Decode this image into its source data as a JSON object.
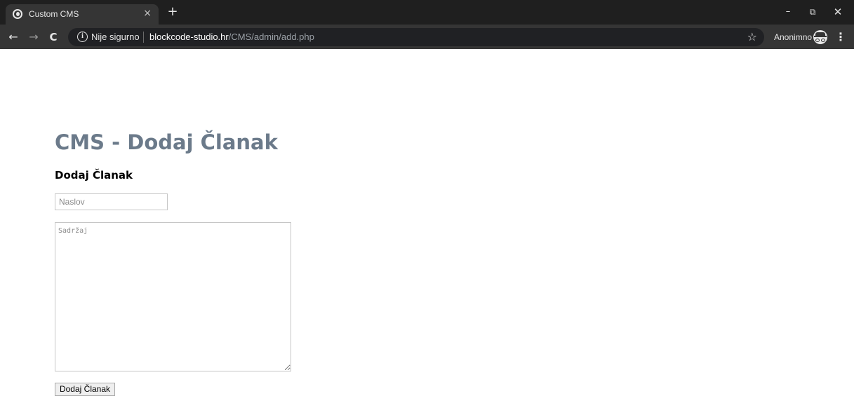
{
  "browser": {
    "tab": {
      "title": "Custom CMS",
      "close_glyph": "×",
      "favicon": "globe-icon"
    },
    "new_tab_glyph": "+",
    "window_controls": {
      "minimize": "–",
      "restore": "⧉",
      "close": "✕"
    },
    "nav": {
      "back": "←",
      "forward": "→",
      "reload": "C"
    },
    "omnibox": {
      "security_icon": "i",
      "security_text": "Nije sigurno",
      "url_host": "blockcode-studio.hr",
      "url_path": "/CMS/admin/add.php",
      "bookmark_glyph": "☆"
    },
    "profile": {
      "label": "Anonimno",
      "icon": "incognito-icon"
    },
    "menu_glyph": "⋮"
  },
  "page": {
    "title": "CMS - Dodaj Članak",
    "form": {
      "heading": "Dodaj Članak",
      "title_field": {
        "placeholder": "Naslov",
        "value": ""
      },
      "content_field": {
        "placeholder": "Sadržaj",
        "value": ""
      },
      "submit_label": "Dodaj Članak"
    }
  },
  "colors": {
    "chrome_dark": "#1f1f1f",
    "toolbar": "#353535",
    "title_text": "#6b7a8a"
  }
}
